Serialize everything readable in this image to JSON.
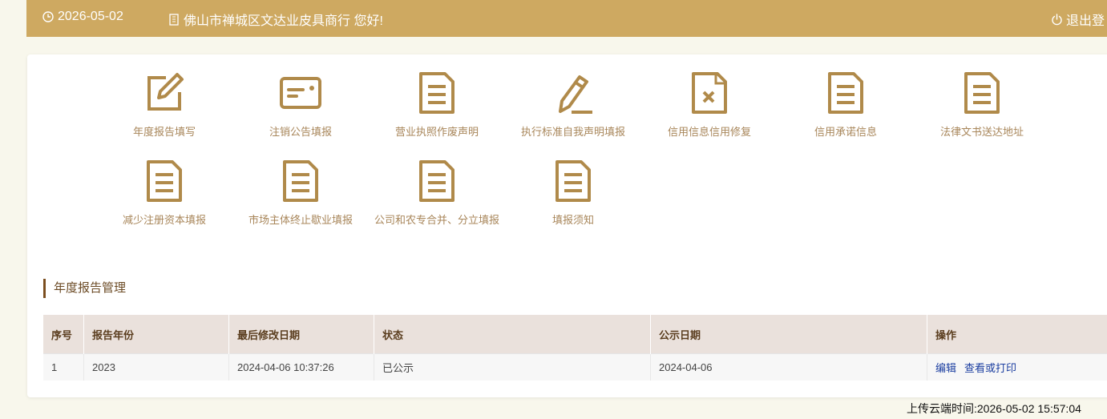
{
  "header": {
    "date": "2026-05-02",
    "company_greeting": "佛山市禅城区文达业皮具商行 您好!",
    "logout_label": "退出登"
  },
  "icons": [
    {
      "label": "年度报告填写",
      "icon": "edit-icon"
    },
    {
      "label": "注销公告填报",
      "icon": "id-card-icon"
    },
    {
      "label": "营业执照作废声明",
      "icon": "document-icon"
    },
    {
      "label": "执行标准自我声明填报",
      "icon": "pencil-icon"
    },
    {
      "label": "信用信息信用修复",
      "icon": "document-x-icon"
    },
    {
      "label": "信用承诺信息",
      "icon": "document-icon"
    },
    {
      "label": "法律文书送达地址",
      "icon": "document-icon"
    },
    {
      "label": "减少注册资本填报",
      "icon": "document-icon"
    },
    {
      "label": "市场主体终止歇业填报",
      "icon": "document-icon"
    },
    {
      "label": "公司和农专合并、分立填报",
      "icon": "document-icon"
    },
    {
      "label": "填报须知",
      "icon": "document-icon"
    }
  ],
  "section": {
    "title": "年度报告管理"
  },
  "table": {
    "headers": [
      "序号",
      "报告年份",
      "最后修改日期",
      "状态",
      "公示日期",
      "操作"
    ],
    "rows": [
      {
        "index": "1",
        "year": "2023",
        "modified": "2024-04-06 10:37:26",
        "status": "已公示",
        "published": "2024-04-06",
        "action_edit": "编辑",
        "action_view": "查看或打印"
      }
    ]
  },
  "footer": {
    "upload_time": "上传云端时间:2026-05-02 15:57:04"
  },
  "colors": {
    "topbar": "#cea961",
    "icon": "#b08a4a",
    "label": "#a8865a",
    "link": "#1b3ea0"
  }
}
